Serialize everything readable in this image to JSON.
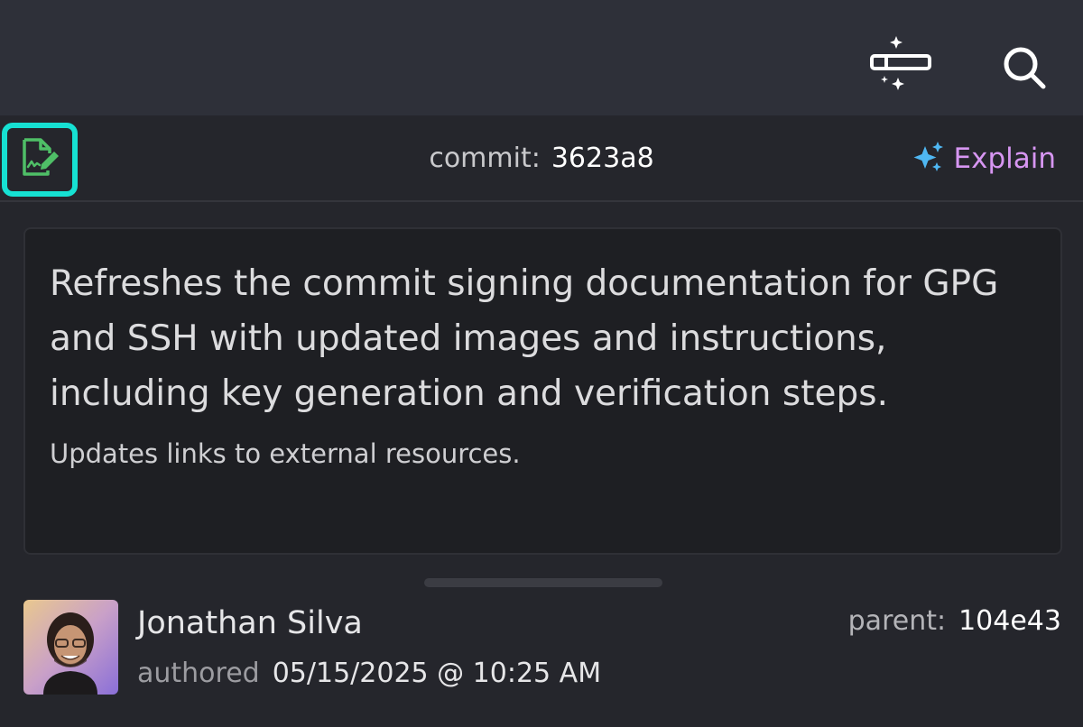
{
  "toolbar": {
    "layout_icon": "layout-toggle-sparkle-icon",
    "search_icon": "search-icon"
  },
  "commit": {
    "sign_icon": "signed-document-icon",
    "label": "commit:",
    "sha": "3623a8",
    "explain_icon": "sparkle-icon",
    "explain_label": "Explain"
  },
  "message": {
    "title": "Refreshes the commit signing documentation for GPG and SSH with updated images and instructions, including key generation and verification steps.",
    "body": "Updates links to external resources."
  },
  "author": {
    "name": "Jonathan Silva",
    "authored_label": "authored",
    "date": "05/15/2025 @ 10:25 AM",
    "parent_label": "parent:",
    "parent_sha": "104e43"
  },
  "colors": {
    "accent_cyan": "#16e1d3",
    "sign_green": "#4fbf67",
    "explain_purple": "#d796f2",
    "sparkle_blue": "#4fb7f2"
  }
}
